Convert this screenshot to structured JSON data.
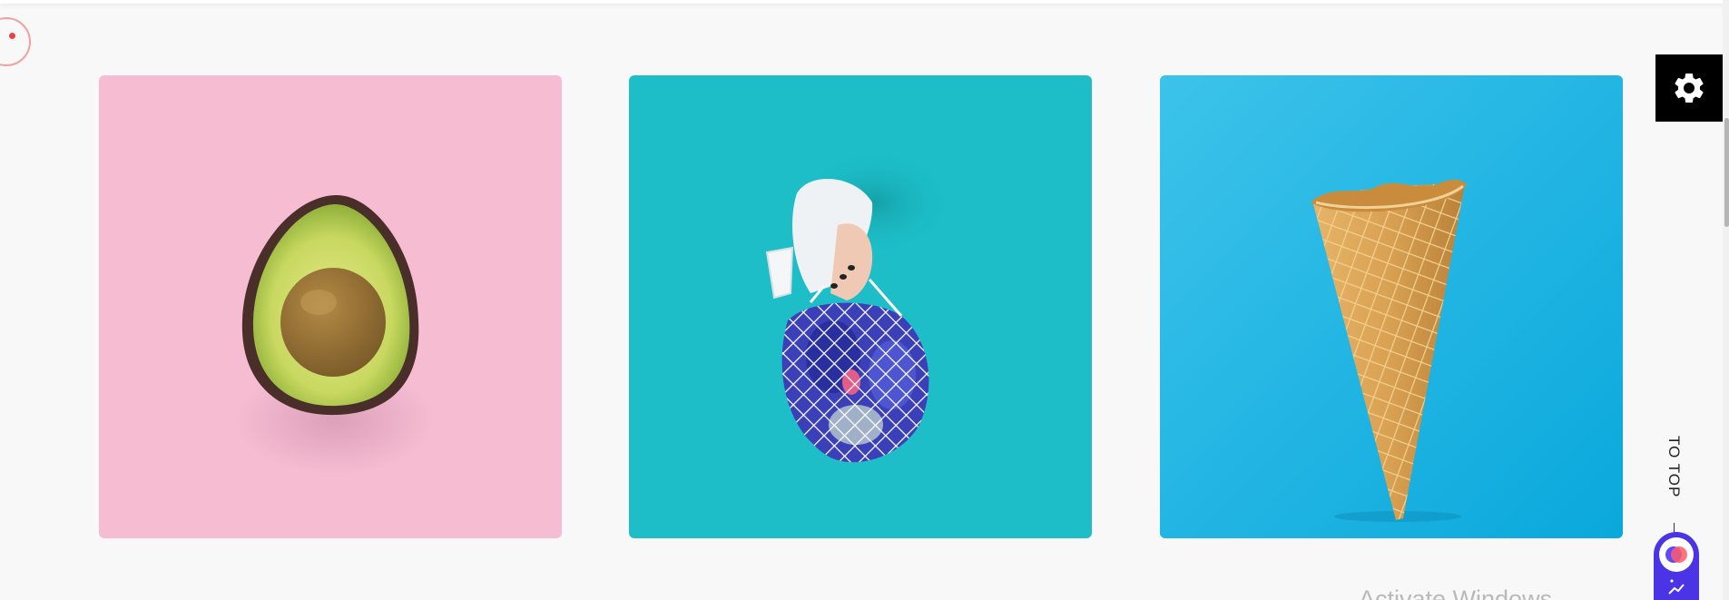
{
  "gallery": {
    "items": [
      {
        "subject": "avocado",
        "background": "#f5bcd2"
      },
      {
        "subject": "mesh-bag",
        "background": "#1dbec8"
      },
      {
        "subject": "ice-cream-cone",
        "background": "#1ab3e2"
      }
    ]
  },
  "settings": {
    "icon": "gear-icon"
  },
  "to_top": {
    "label": "TO TOP"
  },
  "watermark": {
    "text": "Activate Windows"
  },
  "colors": {
    "page_background": "#f8f8f8",
    "settings_button": "#000000",
    "widget_accent": "#4a34e6",
    "cursor_dot": "#e24646"
  }
}
